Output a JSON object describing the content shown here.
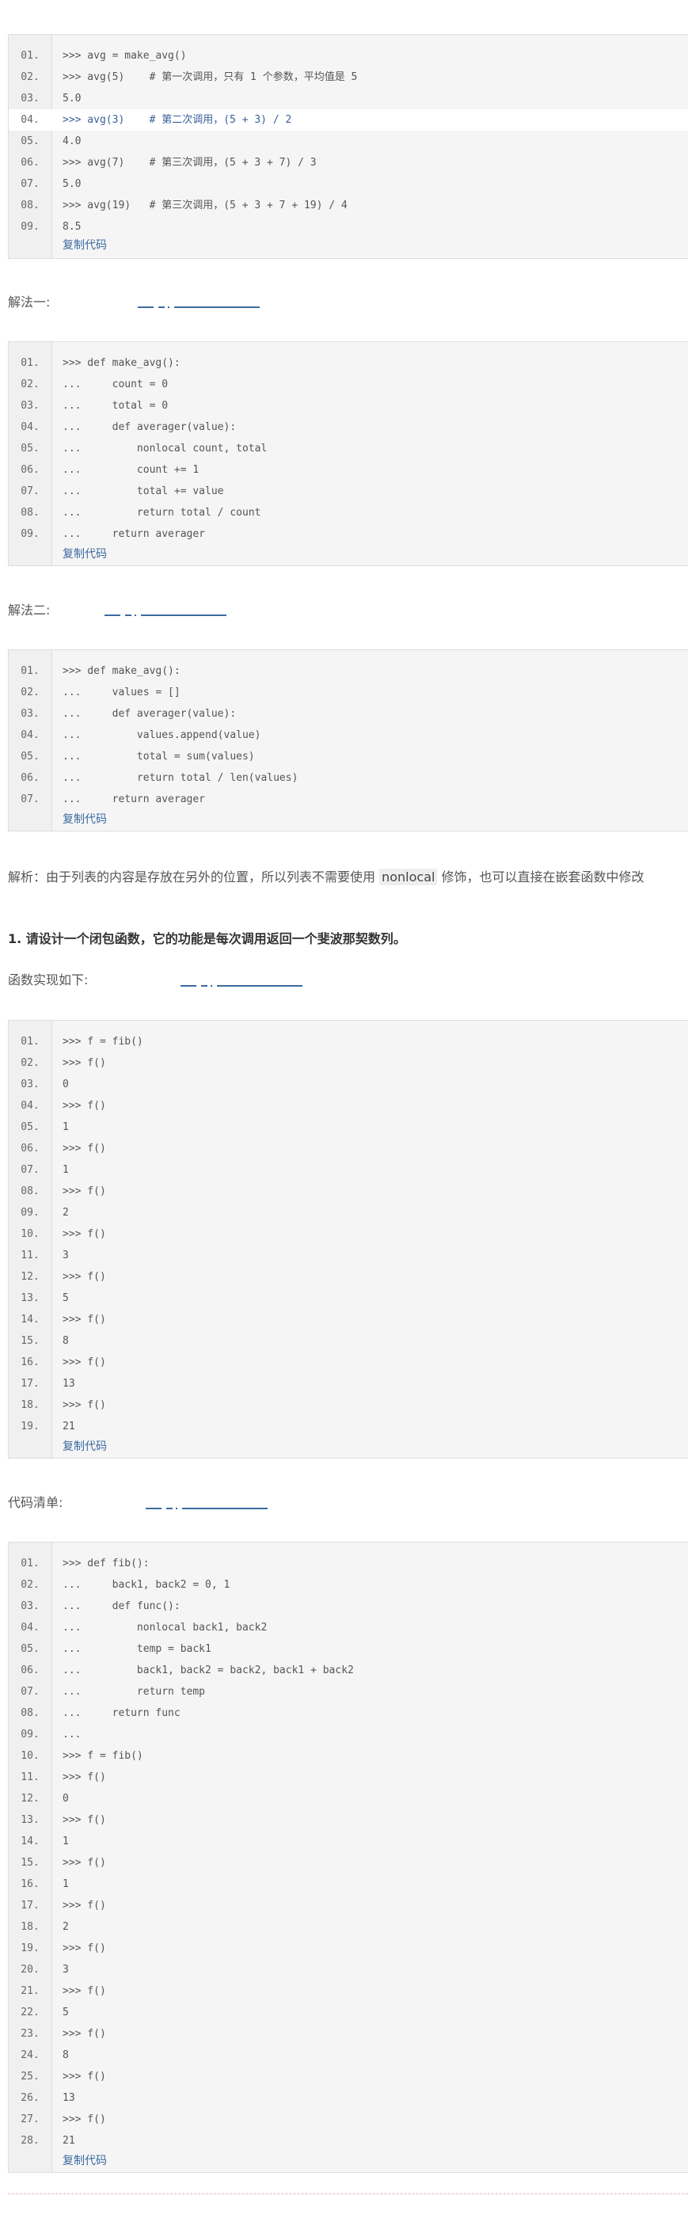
{
  "blocks": [
    {
      "lines": [
        {
          "n": "01.",
          "t": ">>> avg = make_avg()"
        },
        {
          "n": "02.",
          "t": ">>> avg(5)    # 第一次调用，只有 1 个参数，平均值是 5"
        },
        {
          "n": "03.",
          "t": "5.0"
        },
        {
          "n": "04.",
          "t": ">>> avg(3)    # 第二次调用，(5 + 3) / 2",
          "hl": true
        },
        {
          "n": "05.",
          "t": "4.0"
        },
        {
          "n": "06.",
          "t": ">>> avg(7)    # 第三次调用，(5 + 3 + 7) / 3"
        },
        {
          "n": "07.",
          "t": "5.0"
        },
        {
          "n": "08.",
          "t": ">>> avg(19)   # 第三次调用，(5 + 3 + 7 + 19) / 4"
        },
        {
          "n": "09.",
          "t": "8.5"
        }
      ]
    },
    {
      "lines": [
        {
          "n": "01.",
          "t": ">>> def make_avg():"
        },
        {
          "n": "02.",
          "t": "...     count = 0"
        },
        {
          "n": "03.",
          "t": "...     total = 0"
        },
        {
          "n": "04.",
          "t": "...     def averager(value):"
        },
        {
          "n": "05.",
          "t": "...         nonlocal count, total"
        },
        {
          "n": "06.",
          "t": "...         count += 1"
        },
        {
          "n": "07.",
          "t": "...         total += value"
        },
        {
          "n": "08.",
          "t": "...         return total / count"
        },
        {
          "n": "09.",
          "t": "...     return averager"
        }
      ]
    },
    {
      "lines": [
        {
          "n": "01.",
          "t": ">>> def make_avg():"
        },
        {
          "n": "02.",
          "t": "...     values = []"
        },
        {
          "n": "03.",
          "t": "...     def averager(value):"
        },
        {
          "n": "04.",
          "t": "...         values.append(value)"
        },
        {
          "n": "05.",
          "t": "...         total = sum(values)"
        },
        {
          "n": "06.",
          "t": "...         return total / len(values)"
        },
        {
          "n": "07.",
          "t": "...     return averager"
        }
      ]
    },
    {
      "lines": [
        {
          "n": "01.",
          "t": ">>> f = fib()"
        },
        {
          "n": "02.",
          "t": ">>> f()"
        },
        {
          "n": "03.",
          "t": "0"
        },
        {
          "n": "04.",
          "t": ">>> f()"
        },
        {
          "n": "05.",
          "t": "1"
        },
        {
          "n": "06.",
          "t": ">>> f()"
        },
        {
          "n": "07.",
          "t": "1"
        },
        {
          "n": "08.",
          "t": ">>> f()"
        },
        {
          "n": "09.",
          "t": "2"
        },
        {
          "n": "10.",
          "t": ">>> f()"
        },
        {
          "n": "11.",
          "t": "3"
        },
        {
          "n": "12.",
          "t": ">>> f()"
        },
        {
          "n": "13.",
          "t": "5"
        },
        {
          "n": "14.",
          "t": ">>> f()"
        },
        {
          "n": "15.",
          "t": "8"
        },
        {
          "n": "16.",
          "t": ">>> f()"
        },
        {
          "n": "17.",
          "t": "13"
        },
        {
          "n": "18.",
          "t": ">>> f()"
        },
        {
          "n": "19.",
          "t": "21"
        }
      ]
    },
    {
      "lines": [
        {
          "n": "01.",
          "t": ">>> def fib():"
        },
        {
          "n": "02.",
          "t": "...     back1, back2 = 0, 1"
        },
        {
          "n": "03.",
          "t": "...     def func():"
        },
        {
          "n": "04.",
          "t": "...         nonlocal back1, back2"
        },
        {
          "n": "05.",
          "t": "...         temp = back1"
        },
        {
          "n": "06.",
          "t": "...         back1, back2 = back2, back1 + back2"
        },
        {
          "n": "07.",
          "t": "...         return temp"
        },
        {
          "n": "08.",
          "t": "...     return func"
        },
        {
          "n": "09.",
          "t": "..."
        },
        {
          "n": "10.",
          "t": ">>> f = fib()"
        },
        {
          "n": "11.",
          "t": ">>> f()"
        },
        {
          "n": "12.",
          "t": "0"
        },
        {
          "n": "13.",
          "t": ">>> f()"
        },
        {
          "n": "14.",
          "t": "1"
        },
        {
          "n": "15.",
          "t": ">>> f()"
        },
        {
          "n": "16.",
          "t": "1"
        },
        {
          "n": "17.",
          "t": ">>> f()"
        },
        {
          "n": "18.",
          "t": "2"
        },
        {
          "n": "19.",
          "t": ">>> f()"
        },
        {
          "n": "20.",
          "t": "3"
        },
        {
          "n": "21.",
          "t": ">>> f()"
        },
        {
          "n": "22.",
          "t": "5"
        },
        {
          "n": "23.",
          "t": ">>> f()"
        },
        {
          "n": "24.",
          "t": "8"
        },
        {
          "n": "25.",
          "t": ">>> f()"
        },
        {
          "n": "26.",
          "t": "13"
        },
        {
          "n": "27.",
          "t": ">>> f()"
        },
        {
          "n": "28.",
          "t": "21"
        }
      ]
    }
  ],
  "copy_label": "复制代码",
  "text": {
    "solution1": "解法一:",
    "solution2": "解法二:",
    "analysis_pre": "解析：由于列表的内容是存放在另外的位置，所以列表不需要使用 ",
    "analysis_kw": "nonlocal",
    "analysis_post": " 修饰，也可以直接在嵌套函数中修改",
    "question": "1. 请设计一个闭包函数，它的功能是每次调用返回一个斐波那契数列。",
    "impl": "函数实现如下:",
    "listing": "代码清单:"
  },
  "colors": {
    "link": "#3b6aa0",
    "code_bg": "#f5f5f5",
    "border": "#dddddd"
  }
}
